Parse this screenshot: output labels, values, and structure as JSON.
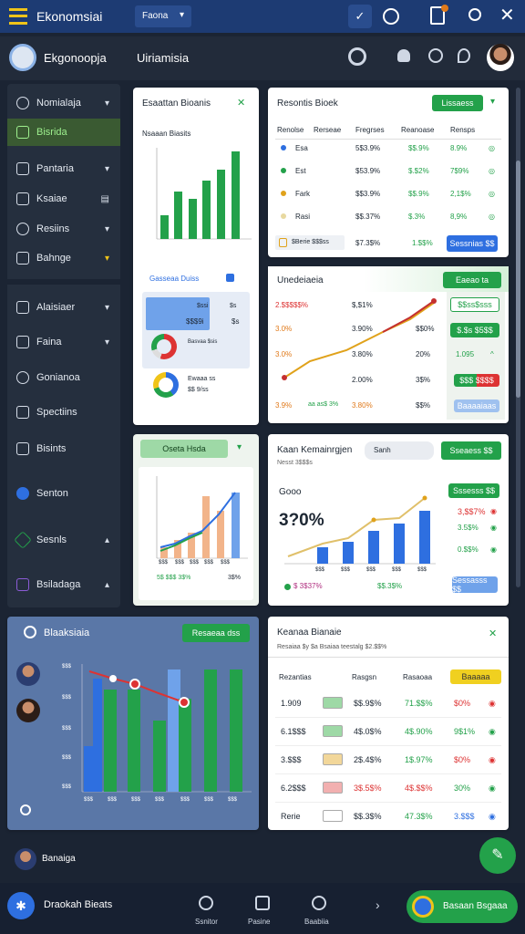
{
  "topbar": {
    "title": "Ekonomsiai",
    "dropdown": "Faona"
  },
  "header": {
    "app_name": "Ekgonoopja",
    "page_title": "Uiriamisia"
  },
  "sidebar": {
    "items": [
      {
        "label": "Nomialaja"
      },
      {
        "label": "Bisrida"
      },
      {
        "label": "Pantaria"
      },
      {
        "label": "Ksaiae"
      },
      {
        "label": "Resiins"
      },
      {
        "label": "Bahnge"
      },
      {
        "label": "Alaisiaer"
      },
      {
        "label": "Faina"
      },
      {
        "label": "Gonianoa"
      },
      {
        "label": "Spectiins"
      },
      {
        "label": "Bisints"
      },
      {
        "label": "Senton"
      },
      {
        "label": "Sesnls"
      },
      {
        "label": "Bsiladaga"
      }
    ],
    "bottom_user": "Banaiga"
  },
  "card1": {
    "title": "Esaattan Bioanis",
    "subtitle": "Nsaaan Biasits",
    "legend_title": "Gasseaa Duiss",
    "row1_a": "$ssi",
    "row1_b": "$s",
    "row1_c": "$$$9i",
    "row1_d": "$s",
    "row2_a": "Basvaa $sis",
    "row3_a": "Ewaaa ss",
    "row3_b": "$$ 9/ss"
  },
  "card2": {
    "title": "Resontis Bioek",
    "btn": "Lissaess",
    "cols": [
      "Renolse",
      "Rerseae",
      "Fregrses",
      "Reanoase",
      "Rensps"
    ],
    "rows": [
      {
        "name": "Esa",
        "c2": "7$3.9%",
        "c3": "5$3.9%",
        "c4": "$$.9%",
        "c5": "8.9%",
        "dot": "#2e6fe0"
      },
      {
        "name": "Est",
        "c2": "",
        "c3": "$53.9%",
        "c4": "$.$2%",
        "c5": "7$9%",
        "dot": "#23a14a"
      },
      {
        "name": "Fark",
        "c2": "",
        "c3": "$$3.9%",
        "c4": "$$.9%",
        "c5": "2,1$%",
        "dot": "#e0a21b"
      },
      {
        "name": "Rasi",
        "c2": "",
        "c3": "$$.37%",
        "c4": "$.3%",
        "c5": "8,9%",
        "dot": "#e8d9a0"
      }
    ],
    "foot_a": "$Berie $$$ss",
    "foot_b": "$7.3$%",
    "foot_c": "1.$$%",
    "foot_btn": "Sessnias $$"
  },
  "card3": {
    "title": "Unedeiaeia",
    "btn": "Eaeao ta",
    "left": [
      "2.$$$$$%",
      "3.0%",
      "3.0%",
      "3.9%"
    ],
    "mid": [
      "$,$1%",
      "3.90%",
      "3.80%",
      "2.00%",
      "3.80%"
    ],
    "right": [
      "$$0%",
      "20%",
      "3$%",
      "$$%"
    ],
    "side": [
      "$$ss$sss",
      "$.$s $5$$",
      "1.095",
      "$$$ $$$$",
      "Baaaaiaas"
    ],
    "bottom_a": "aa as$ 3%"
  },
  "card4": {
    "btn": "Oseta Hsda",
    "xlabels": [
      "$$$",
      "$$$",
      "$$$",
      "$$$",
      "$$$"
    ],
    "foot": "5$ $$$ 3$%",
    "foot_r": "3$%"
  },
  "card5": {
    "title": "Kaan Kemainrgjen",
    "search": "Sanh",
    "btn": "Sseaess $$",
    "sub": "Nesst 3$$$s",
    "big_label": "Gooo",
    "big_value": "3?0%",
    "btn2": "Sssesss $$",
    "side": [
      "3,$$7%",
      "3.5$%",
      "0.$$%"
    ],
    "xlabels": [
      "$$$",
      "$$$",
      "$$$",
      "$$$",
      "$$$"
    ],
    "foot": "$ 3$37%",
    "foot_b": "$$.3$%",
    "foot_btn": "Sessasss $$"
  },
  "card6": {
    "title": "Blaaksiaia",
    "btn": "Resaeaa dss",
    "ylabels": [
      "$$$",
      "$$$",
      "$$$",
      "$$$",
      "$$$"
    ],
    "xlabels": [
      "$$$",
      "$$$",
      "$$$",
      "$$$",
      "$$$",
      "$$$",
      "$$$"
    ]
  },
  "card7": {
    "title": "Keanaa Bianaie",
    "sub": "Resaiaa $y $a Bsaiaa teestalg $2.$$%",
    "cols": [
      "Rezantias",
      "Rasgsn",
      "Rasaoaa",
      "Baaaaa"
    ],
    "rows": [
      {
        "a": "1.909",
        "b": "$$.9$%",
        "c": "71.$$%",
        "d": "$0%",
        "dc": "#d33"
      },
      {
        "a": "6.1$$$",
        "b": "4$.0$%",
        "c": "4$.90%",
        "d": "9$1%",
        "dc": "#23a14a"
      },
      {
        "a": "3.$$$",
        "b": "2$.4$%",
        "c": "1$.97%",
        "d": "$0%",
        "dc": "#d33"
      },
      {
        "a": "6.2$$$",
        "b": "3$.5$%",
        "c": "4$.$$%",
        "d": "30%",
        "dc": "#23a14a"
      },
      {
        "a": "Rerie",
        "b": "$$.3$%",
        "c": "47.3$%",
        "d": "3.$$$",
        "dc": "#2e6fe0"
      }
    ]
  },
  "bottombar": {
    "brand": "Draokah Bieats",
    "tabs": [
      "Ssnitor",
      "Pasine",
      "Baabiia"
    ],
    "cta": "Basaan Bsgaaa"
  },
  "colors": {
    "green": "#23a14a",
    "blue": "#2e6fe0",
    "orange": "#e07a1b",
    "dark": "#1b2433",
    "top": "#1d3b73"
  }
}
